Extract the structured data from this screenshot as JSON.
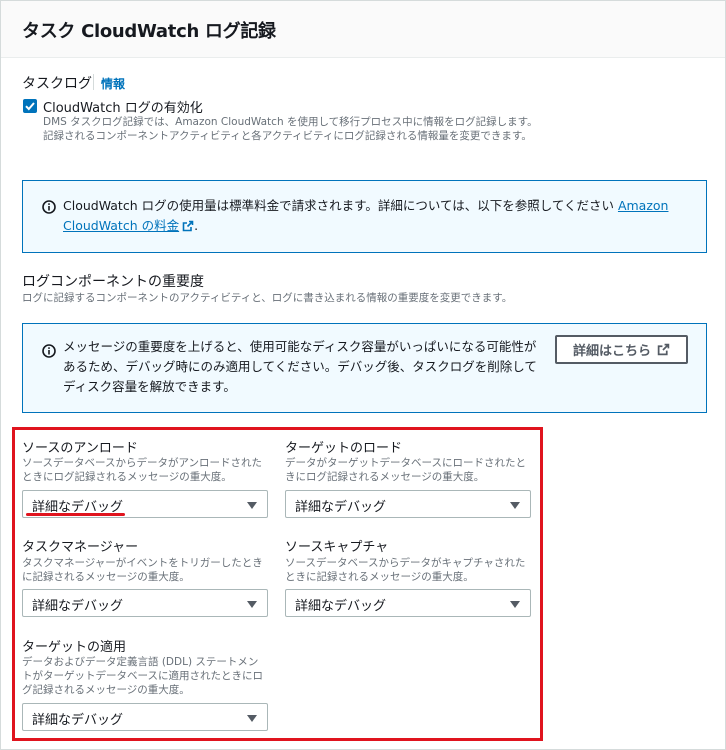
{
  "panel": {
    "title": "タスク CloudWatch ログ記録"
  },
  "task_logs": {
    "label": "タスクログ",
    "info_link": "情報",
    "checkbox_label": "CloudWatch ログの有効化",
    "checkbox_checked": true,
    "description": "DMS タスクログ記録では、Amazon CloudWatch を使用して移行プロセス中に情報をログ記録します。記録されるコンポーネントアクティビティと各アクティビティにログ記録される情報量を変更できます。"
  },
  "alert_billing": {
    "text": "CloudWatch ログの使用量は標準料金で請求されます。詳細については、以下を参照してください ",
    "link_text": "Amazon CloudWatch の料金",
    "trailing": "."
  },
  "severity": {
    "label": "ログコンポーネントの重要度",
    "description": "ログに記録するコンポーネントのアクティビティと、ログに書き込まれる情報の重要度を変更できます。"
  },
  "alert_severity": {
    "text": "メッセージの重要度を上げると、使用可能なディスク容量がいっぱいになる可能性があるため、デバッグ時にのみ適用してください。デバッグ後、タスクログを削除してディスク容量を解放できます。",
    "button_label": "詳細はこちら"
  },
  "fields": {
    "source_unload": {
      "label": "ソースのアンロード",
      "description": "ソースデータベースからデータがアンロードされたときにログ記録されるメッセージの重大度。",
      "value": "詳細なデバッグ"
    },
    "target_load": {
      "label": "ターゲットのロード",
      "description": "データがターゲットデータベースにロードされたときにログ記録されるメッセージの重大度。",
      "value": "詳細なデバッグ"
    },
    "task_manager": {
      "label": "タスクマネージャー",
      "description": "タスクマネージャーがイベントをトリガーしたときに記録されるメッセージの重大度。",
      "value": "詳細なデバッグ"
    },
    "source_capture": {
      "label": "ソースキャプチャ",
      "description": "ソースデータベースからデータがキャプチャされたときに記録されるメッセージの重大度。",
      "value": "詳細なデバッグ"
    },
    "target_apply": {
      "label": "ターゲットの適用",
      "description": "データおよびデータ定義言語 (DDL) ステートメントがターゲットデータベースに適用されたときにログ記録されるメッセージの重大度。",
      "value": "詳細なデバッグ"
    }
  },
  "colors": {
    "accent": "#0073bb",
    "highlight": "#e0141e"
  }
}
